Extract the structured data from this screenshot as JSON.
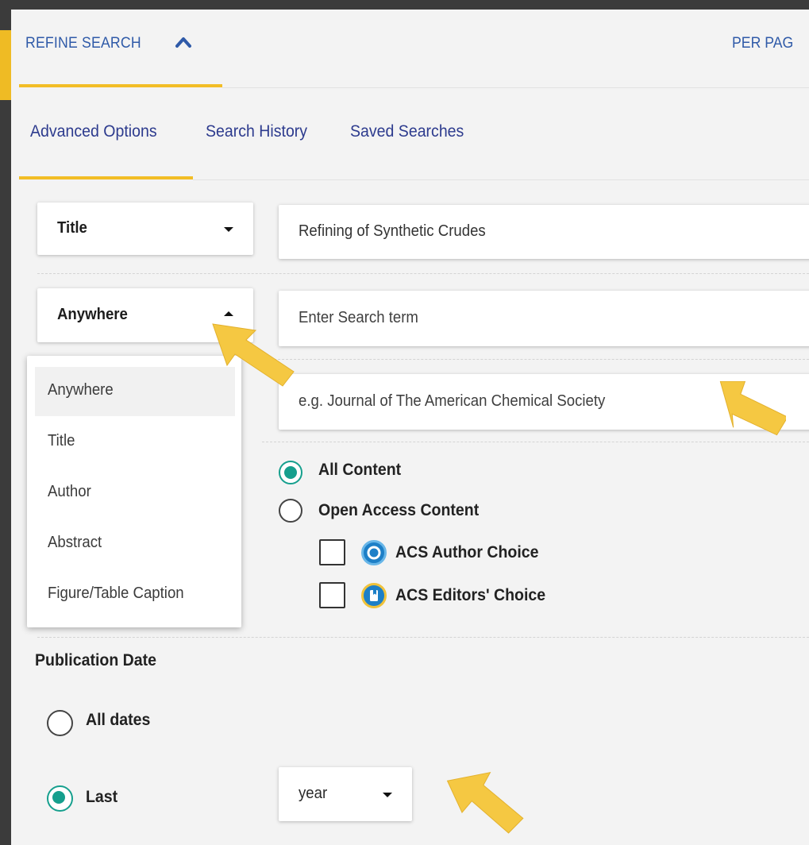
{
  "header": {
    "refine_label": "REFINE SEARCH",
    "per_page_label": "PER PAG"
  },
  "tabs": [
    {
      "label": "Advanced Options",
      "active": true
    },
    {
      "label": "Search History"
    },
    {
      "label": "Saved Searches"
    }
  ],
  "search_rows": [
    {
      "field": "Title",
      "value": "Refining of Synthetic Crudes",
      "dropdown_open": false
    },
    {
      "field": "Anywhere",
      "placeholder": "Enter Search term",
      "dropdown_open": true
    }
  ],
  "journal_input": {
    "placeholder": "e.g. Journal of The American Chemical Society"
  },
  "field_dropdown": {
    "options": [
      "Anywhere",
      "Title",
      "Author",
      "Abstract",
      "Figure/Table Caption"
    ],
    "highlighted": "Anywhere"
  },
  "access": {
    "options": [
      {
        "label": "All Content",
        "selected": true
      },
      {
        "label": "Open Access Content",
        "selected": false
      }
    ],
    "sub_options": [
      {
        "label": "ACS Author Choice",
        "checked": false,
        "icon": "acs-author-choice-icon"
      },
      {
        "label": "ACS Editors' Choice",
        "checked": false,
        "icon": "acs-editors-choice-icon"
      }
    ]
  },
  "publication_date": {
    "title": "Publication Date",
    "options": [
      {
        "label": "All dates",
        "selected": false
      },
      {
        "label": "Last",
        "selected": true
      }
    ],
    "period_value": "year"
  },
  "colors": {
    "accent": "#f2bd26",
    "link": "#2d3b8e",
    "radio": "#159f8d",
    "annotation_arrow": "#f5c842"
  }
}
